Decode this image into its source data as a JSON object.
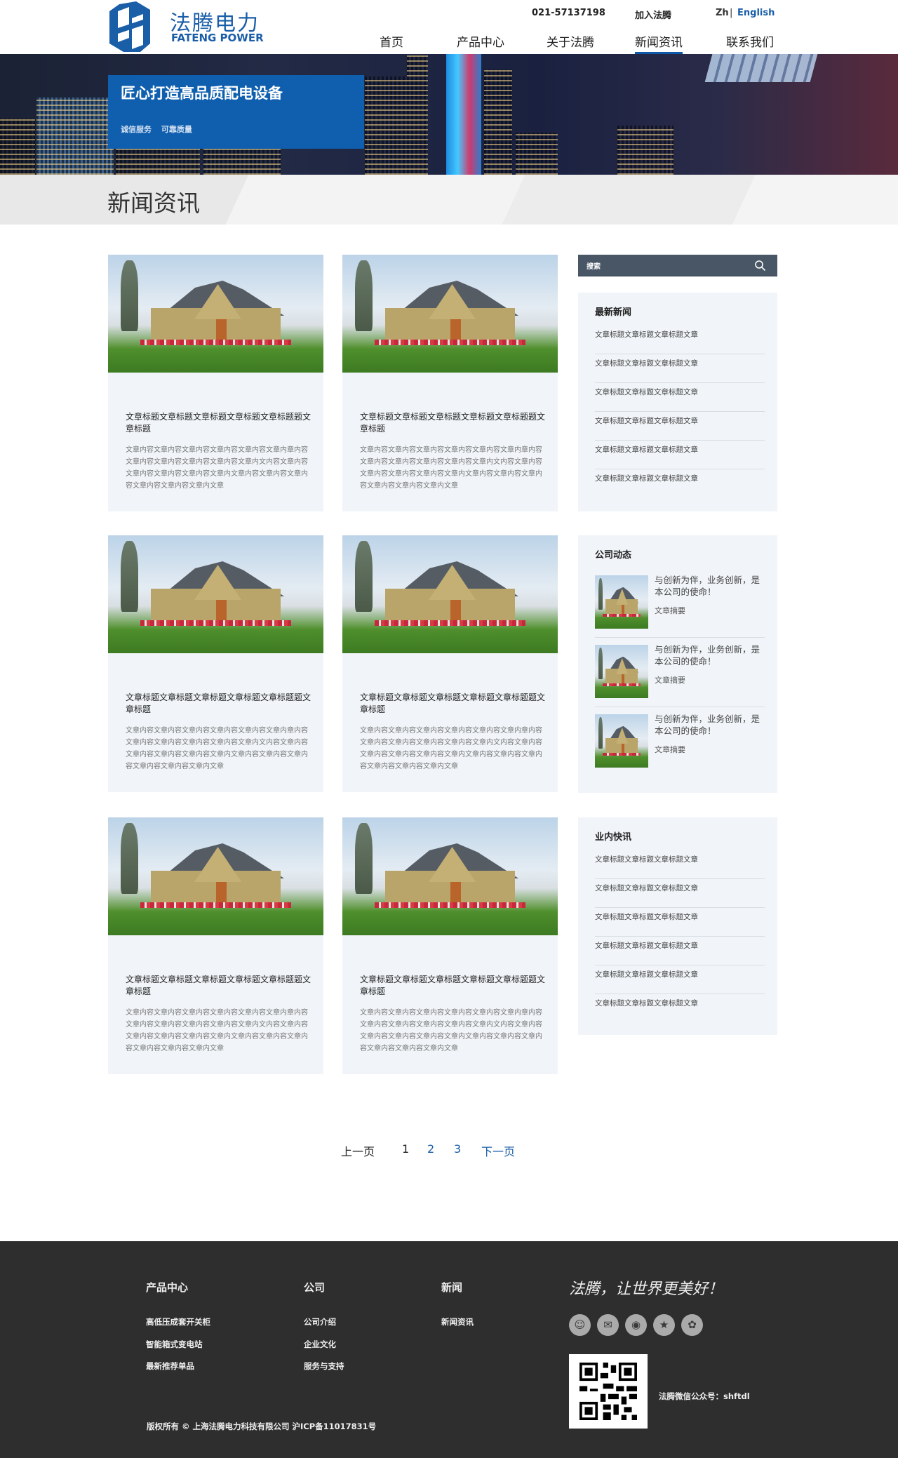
{
  "header": {
    "logo_cn": "法腾电力",
    "logo_en": "FATENG POWER",
    "phone": "021-57137198",
    "join": "加入法腾",
    "lang_zh": "Zh",
    "lang_sep": "|",
    "lang_en": "English",
    "nav": [
      {
        "label": "首页"
      },
      {
        "label": "产品中心"
      },
      {
        "label": "关于法腾"
      },
      {
        "label": "新闻资讯",
        "active": true
      },
      {
        "label": "联系我们"
      }
    ]
  },
  "banner": {
    "title": "匠心打造高品质配电设备",
    "subtitle": "诚信服务 可靠质量"
  },
  "page_title": "新闻资讯",
  "articles": [
    {
      "title": "文章标题文章标题文章标题文章标题文章标题题文章标题",
      "body": "文章内容文章内容文章内容文章内容文章内容文章内章内容文章内容文章内容文章内容文章内容文章内文内容文章内容文章内容文章内容文章内容文章内文章内容文章内容文章内容文章内容文章内容文章内文章"
    },
    {
      "title": "文章标题文章标题文章标题文章标题文章标题题文章标题",
      "body": "文章内容文章内容文章内容文章内容文章内容文章内章内容文章内容文章内容文章内容文章内容文章内文内容文章内容文章内容文章内容文章内容文章内文章内容文章内容文章内容文章内容文章内容文章内文章"
    },
    {
      "title": "文章标题文章标题文章标题文章标题文章标题题文章标题",
      "body": "文章内容文章内容文章内容文章内容文章内容文章内章内容文章内容文章内容文章内容文章内容文章内文内容文章内容文章内容文章内容文章内容文章内文章内容文章内容文章内容文章内容文章内容文章内文章"
    },
    {
      "title": "文章标题文章标题文章标题文章标题文章标题题文章标题",
      "body": "文章内容文章内容文章内容文章内容文章内容文章内章内容文章内容文章内容文章内容文章内容文章内文内容文章内容文章内容文章内容文章内容文章内文章内容文章内容文章内容文章内容文章内容文章内文章"
    },
    {
      "title": "文章标题文章标题文章标题文章标题文章标题题文章标题",
      "body": "文章内容文章内容文章内容文章内容文章内容文章内章内容文章内容文章内容文章内容文章内容文章内文内容文章内容文章内容文章内容文章内容文章内文章内容文章内容文章内容文章内容文章内容文章内文章"
    },
    {
      "title": "文章标题文章标题文章标题文章标题文章标题题文章标题",
      "body": "文章内容文章内容文章内容文章内容文章内容文章内章内容文章内容文章内容文章内容文章内容文章内文内容文章内容文章内容文章内容文章内容文章内文章内容文章内容文章内容文章内容文章内容文章内文章"
    }
  ],
  "sidebar": {
    "search_placeholder": "搜索",
    "latest": {
      "heading": "最新新闻",
      "items": [
        "文章标题文章标题文章标题文章",
        "文章标题文章标题文章标题文章",
        "文章标题文章标题文章标题文章",
        "文章标题文章标题文章标题文章",
        "文章标题文章标题文章标题文章",
        "文章标题文章标题文章标题文章"
      ]
    },
    "company": {
      "heading": "公司动态",
      "items": [
        {
          "title": "与创新为伴，业务创新，是本公司的使命！",
          "summary": "文章摘要"
        },
        {
          "title": "与创新为伴，业务创新，是本公司的使命！",
          "summary": "文章摘要"
        },
        {
          "title": "与创新为伴，业务创新，是本公司的使命！",
          "summary": "文章摘要"
        }
      ]
    },
    "industry": {
      "heading": "业内快讯",
      "items": [
        "文章标题文章标题文章标题文章",
        "文章标题文章标题文章标题文章",
        "文章标题文章标题文章标题文章",
        "文章标题文章标题文章标题文章",
        "文章标题文章标题文章标题文章",
        "文章标题文章标题文章标题文章"
      ]
    }
  },
  "pagination": {
    "prev": "上一页",
    "pages": [
      "1",
      "2",
      "3"
    ],
    "current": "1",
    "next": "下一页"
  },
  "footer": {
    "columns": [
      {
        "heading": "产品中心",
        "links": [
          "高低压成套开关柜",
          "智能箱式变电站",
          "最新推荐单品"
        ]
      },
      {
        "heading": "公司",
        "links": [
          "公司介绍",
          "企业文化",
          "服务与支持"
        ]
      },
      {
        "heading": "新闻",
        "links": [
          "新闻资讯"
        ]
      }
    ],
    "slogan": "法腾，让世界更美好！",
    "social": [
      "qq-icon",
      "wechat-icon",
      "weibo-icon",
      "star-icon",
      "baidu-icon"
    ],
    "wechat": "法腾微信公众号：shftdl",
    "copyright": "版权所有 © 上海法腾电力科技有限公司 沪ICP备11017831号"
  },
  "colors": {
    "brand": "#0f5fae",
    "link": "#1a5ea8",
    "footer_bg": "#2e2e2e"
  }
}
